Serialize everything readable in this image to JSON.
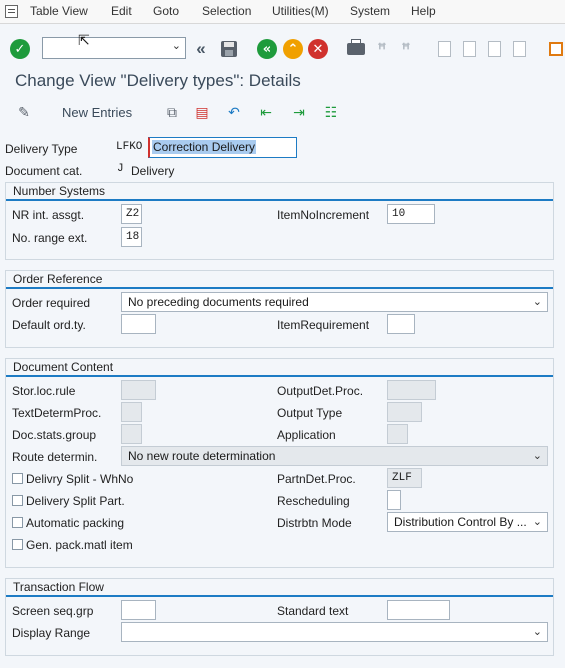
{
  "menu": [
    {
      "id": "table-view",
      "label": "Table View"
    },
    {
      "id": "edit",
      "label": "Edit"
    },
    {
      "id": "goto",
      "label": "Goto"
    },
    {
      "id": "selection",
      "label": "Selection"
    },
    {
      "id": "utilities",
      "label": "Utilities(M)"
    },
    {
      "id": "system",
      "label": "System"
    },
    {
      "id": "help",
      "label": "Help"
    }
  ],
  "title": "Change View \"Delivery types\": Details",
  "app_toolbar": {
    "new_entries": "New Entries"
  },
  "header": {
    "delivery_type_label": "Delivery Type",
    "delivery_type_code": "LFKO",
    "delivery_type_desc": "Correction Delivery",
    "document_cat_label": "Document cat.",
    "document_cat_code": "J",
    "document_cat_desc": "Delivery"
  },
  "number_systems": {
    "title": "Number Systems",
    "nr_int_label": "NR int. assgt.",
    "nr_int_value": "Z2",
    "item_no_inc_label": "ItemNoIncrement",
    "item_no_inc_value": "10",
    "no_range_ext_label": "No. range ext.",
    "no_range_ext_value": "18"
  },
  "order_reference": {
    "title": "Order Reference",
    "order_required_label": "Order required",
    "order_required_value": "No preceding documents required",
    "default_ord_label": "Default ord.ty.",
    "default_ord_value": "",
    "item_requirement_label": "ItemRequirement",
    "item_requirement_value": ""
  },
  "document_content": {
    "title": "Document Content",
    "stor_loc_label": "Stor.loc.rule",
    "output_det_label": "OutputDet.Proc.",
    "text_determ_label": "TextDetermProc.",
    "output_type_label": "Output Type",
    "doc_stats_label": "Doc.stats.group",
    "application_label": "Application",
    "route_determ_label": "Route determin.",
    "route_determ_value": "No new route determination",
    "delivery_split_whno_label": "Delivry Split - WhNo",
    "partn_det_label": "PartnDet.Proc.",
    "partn_det_value": "ZLF",
    "delivery_split_part_label": "Delivery Split Part.",
    "rescheduling_label": "Rescheduling",
    "automatic_packing_label": "Automatic packing",
    "distrbtn_mode_label": "Distrbtn Mode",
    "distrbtn_mode_value": "Distribution Control By ...",
    "gen_pack_label": "Gen. pack.matl item"
  },
  "transaction_flow": {
    "title": "Transaction Flow",
    "screen_seq_label": "Screen seq.grp",
    "standard_text_label": "Standard text",
    "display_range_label": "Display Range",
    "display_range_value": ""
  },
  "colors": {
    "accent": "#1d7bc4",
    "ok_green": "#1e9b3c",
    "cancel_red": "#d0312d",
    "exit_orange": "#f0a000"
  }
}
